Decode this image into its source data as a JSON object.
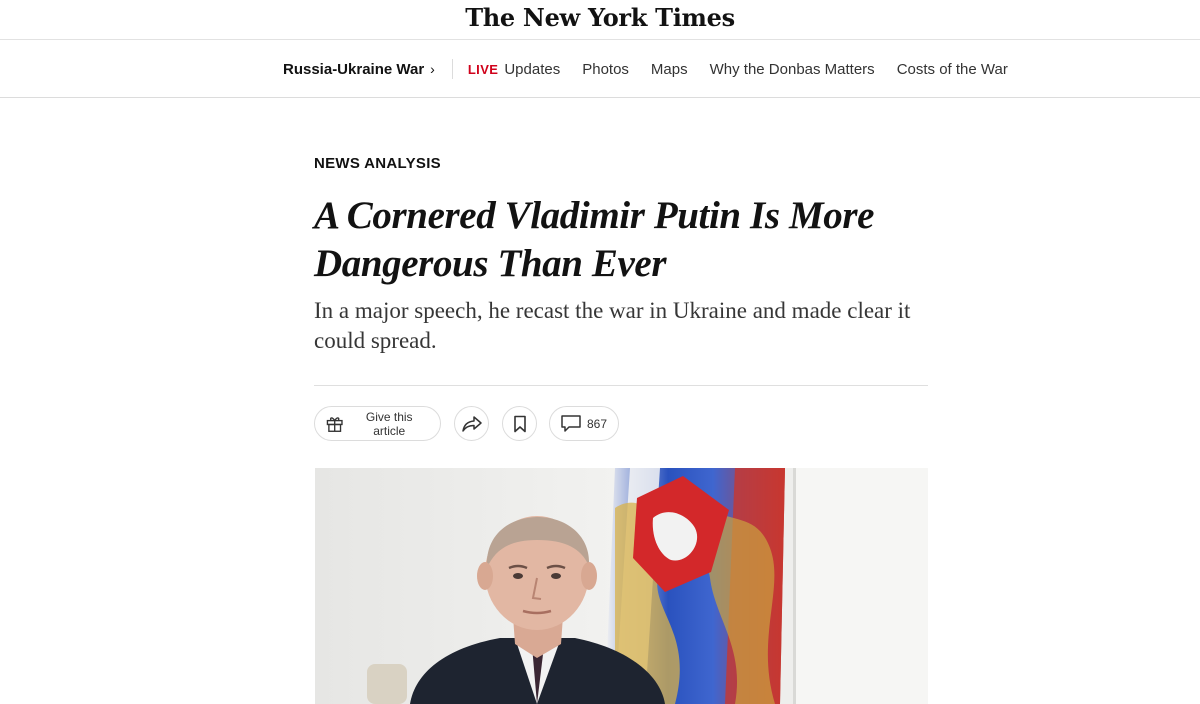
{
  "masthead": {
    "logo": "The New York Times"
  },
  "subnav": {
    "section": "Russia-Ukraine War",
    "section_chevron": "›",
    "live_badge": "LIVE",
    "items": [
      "Updates",
      "Photos",
      "Maps",
      "Why the Donbas Matters",
      "Costs of the War"
    ]
  },
  "article": {
    "kicker": "NEWS ANALYSIS",
    "headline": "A Cornered Vladimir Putin Is More Dangerous Than Ever",
    "summary": "In a major speech, he recast the war in Ukraine and made clear it could spread."
  },
  "actions": {
    "gift_label": "Give this article",
    "comment_count": "867",
    "icons": [
      "gift-icon",
      "share-icon",
      "bookmark-icon",
      "comment-icon"
    ]
  },
  "colors": {
    "live_red": "#d0021b",
    "divider": "#dfdfdf",
    "text": "#121212"
  }
}
